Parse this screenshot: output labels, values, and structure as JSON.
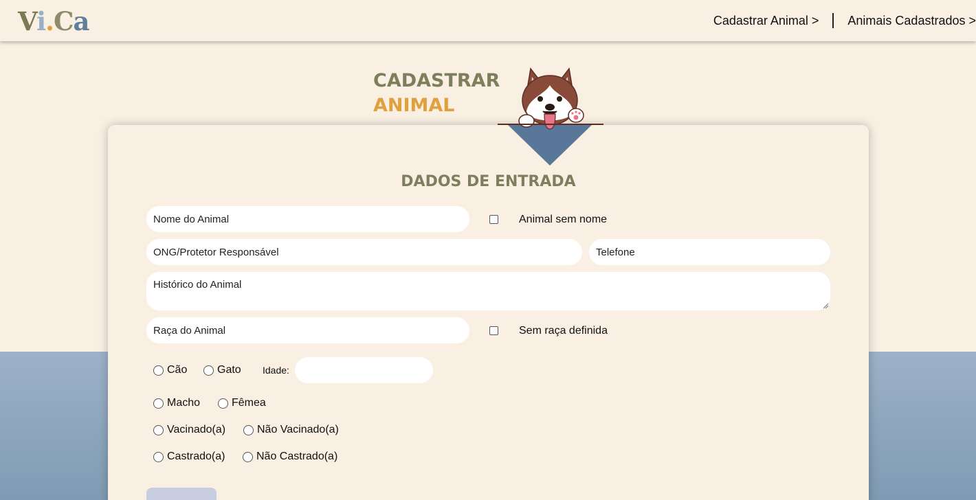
{
  "header": {
    "logo": {
      "p1": "V",
      "p2": "i",
      "p3": ".",
      "p4": "C",
      "p5": "a"
    },
    "nav": [
      {
        "label": "Cadastrar Animal >"
      },
      {
        "label": "Animais Cadastrados >"
      }
    ]
  },
  "title": {
    "line1": "CADASTRAR",
    "line2": "ANIMAL"
  },
  "form": {
    "section_title": "DADOS DE ENTRADA",
    "nome_placeholder": "Nome do Animal",
    "sem_nome_label": "Animal sem nome",
    "ong_placeholder": "ONG/Protetor Responsável",
    "telefone_placeholder": "Telefone",
    "historico_placeholder": "Histórico do Animal",
    "raca_placeholder": "Raça do Animal",
    "sem_raca_label": "Sem raça definida",
    "especie": [
      "Cão",
      "Gato"
    ],
    "idade_label": "Idade:",
    "sexo": [
      "Macho",
      "Fêmea"
    ],
    "vacina": [
      "Vacinado(a)",
      "Não Vacinado(a)"
    ],
    "castracao": [
      "Castrado(a)",
      "Não Castrado(a)"
    ]
  },
  "colors": {
    "background": "#f9f0e3",
    "olive": "#7d7f5c",
    "orange": "#e0a03e",
    "slate_blue": "#587799",
    "bottom_band": "#8fa7bf",
    "button": "#c9cde0"
  },
  "icons": {
    "mascot": "husky-dog-icon"
  }
}
